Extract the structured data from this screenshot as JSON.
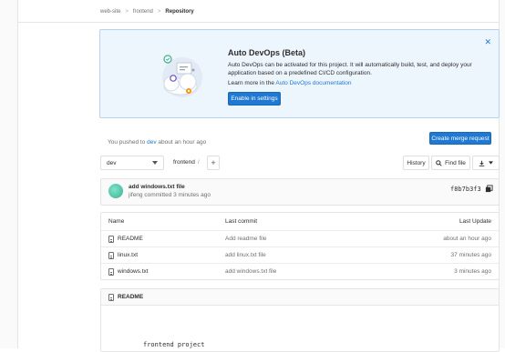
{
  "breadcrumb": {
    "items": [
      "web-site",
      "frontend",
      "Repository"
    ],
    "separator": ">"
  },
  "devops": {
    "title": "Auto DevOps (Beta)",
    "description": "Auto DevOps can be activated for this project. It will automatically build, test, and deploy your application based on a predefined CI/CD configuration.",
    "learn_prefix": "Learn more in the ",
    "learn_link": "Auto DevOps documentation",
    "enable_button": "Enable in settings",
    "close_icon": "close-icon"
  },
  "push_notice": {
    "prefix": "You pushed to ",
    "branch": "dev",
    "suffix": " about an hour ago",
    "button": "Create merge request"
  },
  "toolbar": {
    "branch": "dev",
    "path": "frontend",
    "path_sep": "/",
    "plus": "+",
    "history": "History",
    "find_file": "Find file"
  },
  "commit": {
    "message": "add windows.txt file",
    "meta": "jifeng committed 3 minutes ago",
    "sha": "f8b7b3f3"
  },
  "files": {
    "headers": {
      "name": "Name",
      "last_commit": "Last commit",
      "last_update": "Last Update"
    },
    "rows": [
      {
        "name": "README",
        "commit": "Add readme file",
        "updated": "about an hour ago"
      },
      {
        "name": "linux.txt",
        "commit": "add linux.txt file",
        "updated": "37 minutes ago"
      },
      {
        "name": "windows.txt",
        "commit": "add windows.txt file",
        "updated": "3 minutes ago"
      }
    ]
  },
  "readme": {
    "title": "README",
    "content": "frontend project"
  },
  "colors": {
    "accent": "#1f78d1",
    "banner_bg": "#eef6fd",
    "banner_border": "#b7d3ee"
  }
}
